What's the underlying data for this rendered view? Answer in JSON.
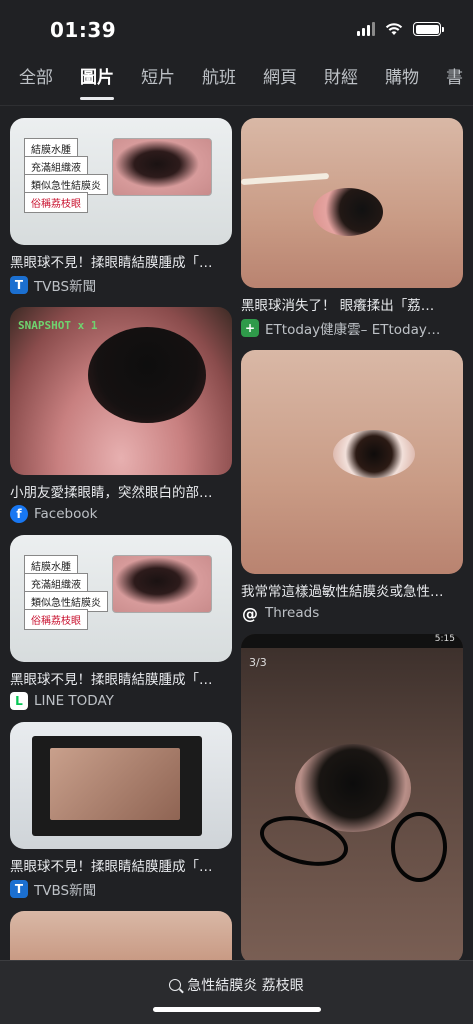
{
  "status": {
    "time": "01:39"
  },
  "tabs": [
    {
      "label": "全部",
      "active": false
    },
    {
      "label": "圖片",
      "active": true
    },
    {
      "label": "短片",
      "active": false
    },
    {
      "label": "航班",
      "active": false
    },
    {
      "label": "網頁",
      "active": false
    },
    {
      "label": "財經",
      "active": false
    },
    {
      "label": "購物",
      "active": false
    },
    {
      "label": "書",
      "active": false
    }
  ],
  "left_results": [
    {
      "caption": "黑眼球不見！揉眼睛結膜腫成「…",
      "source": "TVBS新聞",
      "labels": [
        "結膜水腫",
        "充滿組織液",
        "類似急性結膜炎",
        "俗稱荔枝眼"
      ]
    },
    {
      "caption": "小朋友愛揉眼睛，突然眼白的部…",
      "source": "Facebook",
      "overlay": "SNAPSHOT x 1"
    },
    {
      "caption": "黑眼球不見！揉眼睛結膜腫成「…",
      "source": "LINE TODAY",
      "labels": [
        "結膜水腫",
        "充滿組織液",
        "類似急性結膜炎",
        "俗稱荔枝眼"
      ]
    },
    {
      "caption": "黑眼球不見！揉眼睛結膜腫成「…",
      "source": "TVBS新聞"
    }
  ],
  "right_results": [
    {
      "caption": "黑眼球消失了！ 眼癢揉出「荔…",
      "source": "ETtoday健康雲– ETtoday…"
    },
    {
      "caption": "我常常這樣過敏性結膜炎或急性…",
      "source": "Threads"
    },
    {
      "phone_time": "5:15",
      "page_indicator": "3/3"
    }
  ],
  "search": {
    "query": "急性結膜炎 荔枝眼"
  }
}
